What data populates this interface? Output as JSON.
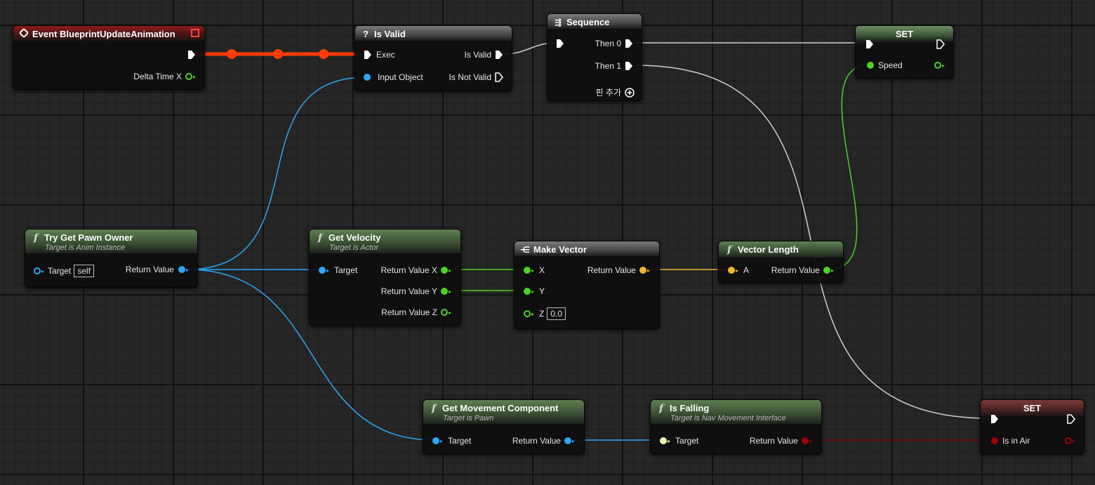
{
  "colors": {
    "exec_wire": "#ff3b0a",
    "white_wire": "#cfcfcf",
    "object_wire": "#29a8f5",
    "float_wire": "#4dd22a",
    "vector_wire": "#f2b62c",
    "bool_wire": "#8a0000"
  },
  "nodes": {
    "event": {
      "title": "Event BlueprintUpdateAnimation",
      "icon": "event-diamond-icon",
      "out_delta": "Delta Time X"
    },
    "isvalid": {
      "title": "Is Valid",
      "icon": "question-icon",
      "in_exec": "Exec",
      "in_object": "Input Object",
      "out_valid": "Is Valid",
      "out_notvalid": "Is Not Valid"
    },
    "sequence": {
      "title": "Sequence",
      "icon": "sequence-icon",
      "then0": "Then 0",
      "then1": "Then 1",
      "add_pin": "핀 추가"
    },
    "set_speed": {
      "title": "SET",
      "var": "Speed"
    },
    "pawnowner": {
      "title": "Try Get Pawn Owner",
      "subtitle": "Target is Anim Instance",
      "target": "Target",
      "target_default": "self",
      "ret": "Return Value"
    },
    "velocity": {
      "title": "Get Velocity",
      "subtitle": "Target is Actor",
      "target": "Target",
      "retx": "Return Value X",
      "rety": "Return Value Y",
      "retz": "Return Value Z"
    },
    "makevector": {
      "title": "Make Vector",
      "icon": "make-struct-icon",
      "x": "X",
      "y": "Y",
      "z": "Z",
      "z_default": "0.0",
      "ret": "Return Value"
    },
    "vectorlength": {
      "title": "Vector Length",
      "a": "A",
      "ret": "Return Value"
    },
    "movement": {
      "title": "Get Movement Component",
      "subtitle": "Target is Pawn",
      "target": "Target",
      "ret": "Return Value"
    },
    "isfalling": {
      "title": "Is Falling",
      "subtitle": "Target is Nav Movement Interface",
      "target": "Target",
      "ret": "Return Value"
    },
    "set_inair": {
      "title": "SET",
      "var": "Is in Air"
    }
  }
}
